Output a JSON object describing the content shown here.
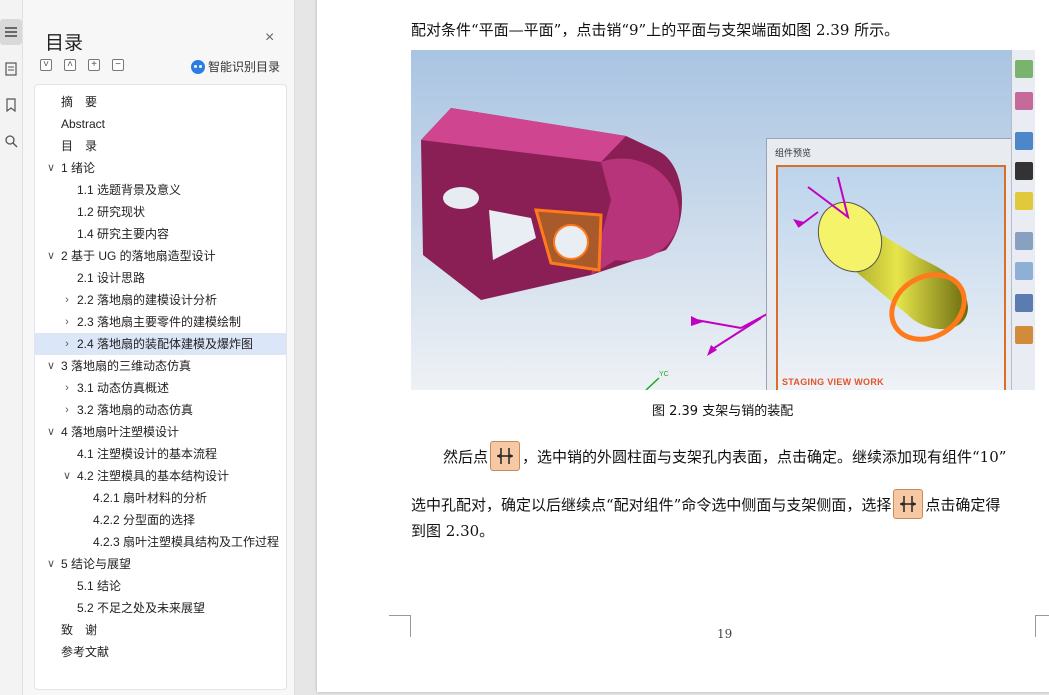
{
  "rail": {
    "items": [
      {
        "name": "toc-view-icon",
        "active": true
      },
      {
        "name": "page-thumbnail-icon",
        "active": false
      },
      {
        "name": "bookmark-icon",
        "active": false
      },
      {
        "name": "find-icon",
        "active": false
      }
    ]
  },
  "toc": {
    "title": "目录",
    "close_glyph": "×",
    "smart_label": "智能识别目录",
    "items": [
      {
        "label": "摘　要",
        "level": 0,
        "chevron": ""
      },
      {
        "label": "Abstract",
        "level": 0,
        "chevron": ""
      },
      {
        "label": "目　录",
        "level": 0,
        "chevron": ""
      },
      {
        "label": "1  绪论",
        "level": 0,
        "chevron": "∨"
      },
      {
        "label": "1.1  选题背景及意义",
        "level": 1,
        "chevron": ""
      },
      {
        "label": "1.2 研究现状",
        "level": 1,
        "chevron": ""
      },
      {
        "label": "1.4  研究主要内容",
        "level": 1,
        "chevron": ""
      },
      {
        "label": "2  基于 UG 的落地扇造型设计",
        "level": 0,
        "chevron": "∨"
      },
      {
        "label": "2.1  设计思路",
        "level": 1,
        "chevron": ""
      },
      {
        "label": "2.2  落地扇的建模设计分析",
        "level": 1,
        "chevron": "›"
      },
      {
        "label": "2.3  落地扇主要零件的建模绘制",
        "level": 1,
        "chevron": "›"
      },
      {
        "label": "2.4  落地扇的装配体建模及爆炸图",
        "level": 1,
        "chevron": "›",
        "selected": true
      },
      {
        "label": "3  落地扇的三维动态仿真",
        "level": 0,
        "chevron": "∨"
      },
      {
        "label": "3.1  动态仿真概述",
        "level": 1,
        "chevron": "›"
      },
      {
        "label": "3.2  落地扇的动态仿真",
        "level": 1,
        "chevron": "›"
      },
      {
        "label": "4  落地扇叶注塑模设计",
        "level": 0,
        "chevron": "∨"
      },
      {
        "label": "4.1  注塑模设计的基本流程",
        "level": 1,
        "chevron": ""
      },
      {
        "label": "4.2  注塑模具的基本结构设计",
        "level": 1,
        "chevron": "∨"
      },
      {
        "label": "4.2.1  扇叶材料的分析",
        "level": 2,
        "chevron": ""
      },
      {
        "label": "4.2.2  分型面的选择",
        "level": 2,
        "chevron": ""
      },
      {
        "label": "4.2.3  扇叶注塑模具结构及工作过程",
        "level": 2,
        "chevron": ""
      },
      {
        "label": "5  结论与展望",
        "level": 0,
        "chevron": "∨"
      },
      {
        "label": "5.1 结论",
        "level": 1,
        "chevron": ""
      },
      {
        "label": "5.2 不足之处及未来展望",
        "level": 1,
        "chevron": ""
      },
      {
        "label": "致　谢",
        "level": 0,
        "chevron": ""
      },
      {
        "label": "参考文献",
        "level": 0,
        "chevron": ""
      }
    ]
  },
  "document": {
    "line1": "配对条件“平面—平面”，点击销“9”上的平面与支架端面如图 2.39 所示。",
    "figure_caption": "图 2.39 支架与销的装配",
    "para_a_prefix": "然后点",
    "para_a_suffix": "，选中销的外圆柱面与支架孔内表面，点击确定。继续添加现有组件“10”",
    "para_b_prefix": "选中孔配对，确定以后继续点“配对组件”命令选中侧面与支架侧面，选择",
    "para_b_suffix": "点击确定得",
    "para_c": "到图 2.30。",
    "page_number": "19",
    "preview_title": "组件预览",
    "preview_footer": "STAGING  VIEW WORK",
    "axis_label": "YC"
  }
}
